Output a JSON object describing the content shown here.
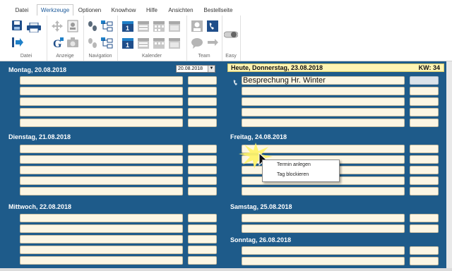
{
  "menu": {
    "tabs": [
      {
        "label": "Datei"
      },
      {
        "label": "Werkzeuge"
      },
      {
        "label": "Optionen"
      },
      {
        "label": "Knowhow"
      },
      {
        "label": "Hilfe"
      },
      {
        "label": "Ansichten"
      },
      {
        "label": "Bestellseite"
      }
    ],
    "active_tab": "Werkzeuge"
  },
  "ribbon": {
    "groups": [
      {
        "label": "Datei",
        "icons": [
          "save-icon",
          "print-icon",
          "exit-icon"
        ]
      },
      {
        "label": "Anzeige",
        "icons": [
          "move-icon",
          "contact-card-icon",
          "google-icon",
          "camera-icon"
        ]
      },
      {
        "label": "Navigation",
        "icons": [
          "footsteps-icon",
          "tree-icon",
          "footsteps-icon",
          "tree-icon"
        ]
      },
      {
        "label": "Kalender",
        "icons": [
          "day-view-icon",
          "week-view-icon",
          "month-view-icon",
          "year-view-icon",
          "day-view-icon",
          "week-view-icon",
          "month-view-icon",
          "year-view-icon"
        ]
      },
      {
        "label": "Team",
        "icons": [
          "person-icon",
          "phone-icon",
          "chat-icon",
          "transfer-icon"
        ]
      },
      {
        "label": "Easy",
        "icons": [
          "toggle-icon"
        ]
      }
    ]
  },
  "calendar": {
    "date_picker_value": "20.08.2018",
    "today": {
      "title": "Heute, Donnerstag, 23.08.2018",
      "kw": "KW: 34"
    },
    "days": {
      "mon": "Montag, 20.08.2018",
      "tue": "Dienstag, 21.08.2018",
      "wed": "Mittwoch, 22.08.2018",
      "fri": "Freitag, 24.08.2018",
      "sat": "Samstag, 25.08.2018",
      "sun": "Sonntag, 26.08.2018"
    },
    "appointment": "Besprechung Hr. Winter"
  },
  "context_menu": {
    "items": [
      {
        "label": "Termin anlegen"
      },
      {
        "label": "Tag blockieren"
      }
    ]
  },
  "colors": {
    "background": "#1e5b8a",
    "slot": "#fcf6e4",
    "today_bar": "#fff4b3",
    "accent": "#1d5a9a"
  }
}
